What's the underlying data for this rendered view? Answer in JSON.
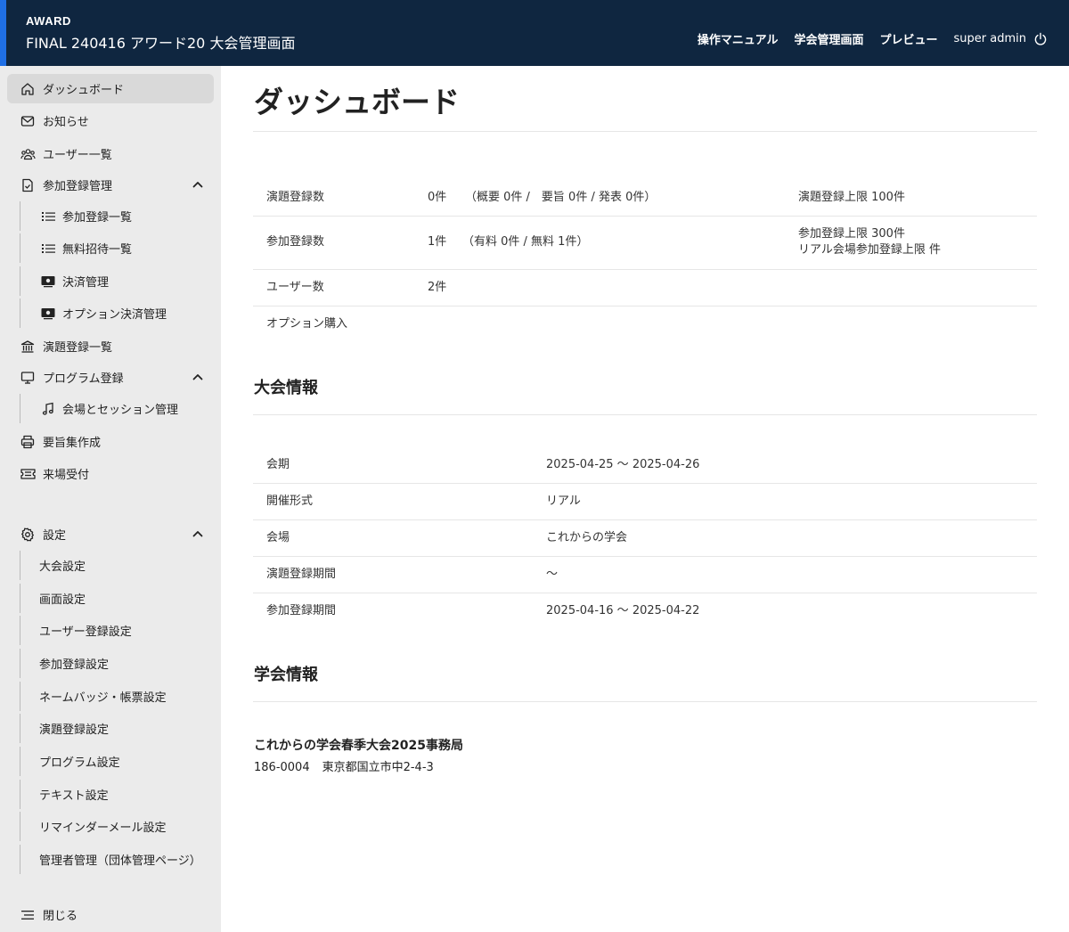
{
  "header": {
    "brand": "AWARD",
    "title": "FINAL 240416 アワード20 大会管理画面",
    "nav": {
      "manual": "操作マニュアル",
      "society_admin": "学会管理画面",
      "preview": "プレビュー",
      "user": "super admin"
    }
  },
  "sidebar": {
    "dashboard": "ダッシュボード",
    "notices": "お知らせ",
    "user_list": "ユーザー一覧",
    "registration_mgmt": "参加登録管理",
    "registration_list": "参加登録一覧",
    "free_invite_list": "無料招待一覧",
    "payment_mgmt": "決済管理",
    "option_payment_mgmt": "オプション決済管理",
    "abstract_list": "演題登録一覧",
    "program_registration": "プログラム登録",
    "venue_session_mgmt": "会場とセッション管理",
    "abstract_book": "要旨集作成",
    "reception": "来場受付",
    "settings": "設定",
    "settings_items": {
      "conference": "大会設定",
      "screen": "画面設定",
      "user_registration": "ユーザー登録設定",
      "participation": "参加登録設定",
      "name_badge": "ネームバッジ・帳票設定",
      "abstract": "演題登録設定",
      "program": "プログラム設定",
      "text": "テキスト設定",
      "reminder": "リマインダーメール設定",
      "admin": "管理者管理（団体管理ページ）"
    },
    "close": "閉じる"
  },
  "main": {
    "title": "ダッシュボード",
    "stats": {
      "abstracts": {
        "label": "演題登録数",
        "value": "0件",
        "detail": "（概要 0件 /　要旨 0件 / 発表 0件）",
        "limit": "演題登録上限 100件"
      },
      "participants": {
        "label": "参加登録数",
        "value": "1件",
        "detail": "（有料 0件 / 無料 1件）",
        "limit1": "参加登録上限 300件",
        "limit2": "リアル会場参加登録上限 件"
      },
      "users": {
        "label": "ユーザー数",
        "value": "2件"
      },
      "options": {
        "label": "オプション購入"
      }
    },
    "conference_info": {
      "title": "大会情報",
      "period": {
        "label": "会期",
        "value": "2025-04-25 〜 2025-04-26"
      },
      "format": {
        "label": "開催形式",
        "value": "リアル"
      },
      "venue": {
        "label": "会場",
        "value": "これからの学会"
      },
      "abstract_period": {
        "label": "演題登録期間",
        "value": "〜"
      },
      "registration_period": {
        "label": "参加登録期間",
        "value": "2025-04-16 〜 2025-04-22"
      }
    },
    "society_info": {
      "title": "学会情報",
      "name": "これからの学会春季大会2025事務局",
      "postal": "186-0004",
      "address": "東京都国立市中2-4-3"
    }
  }
}
